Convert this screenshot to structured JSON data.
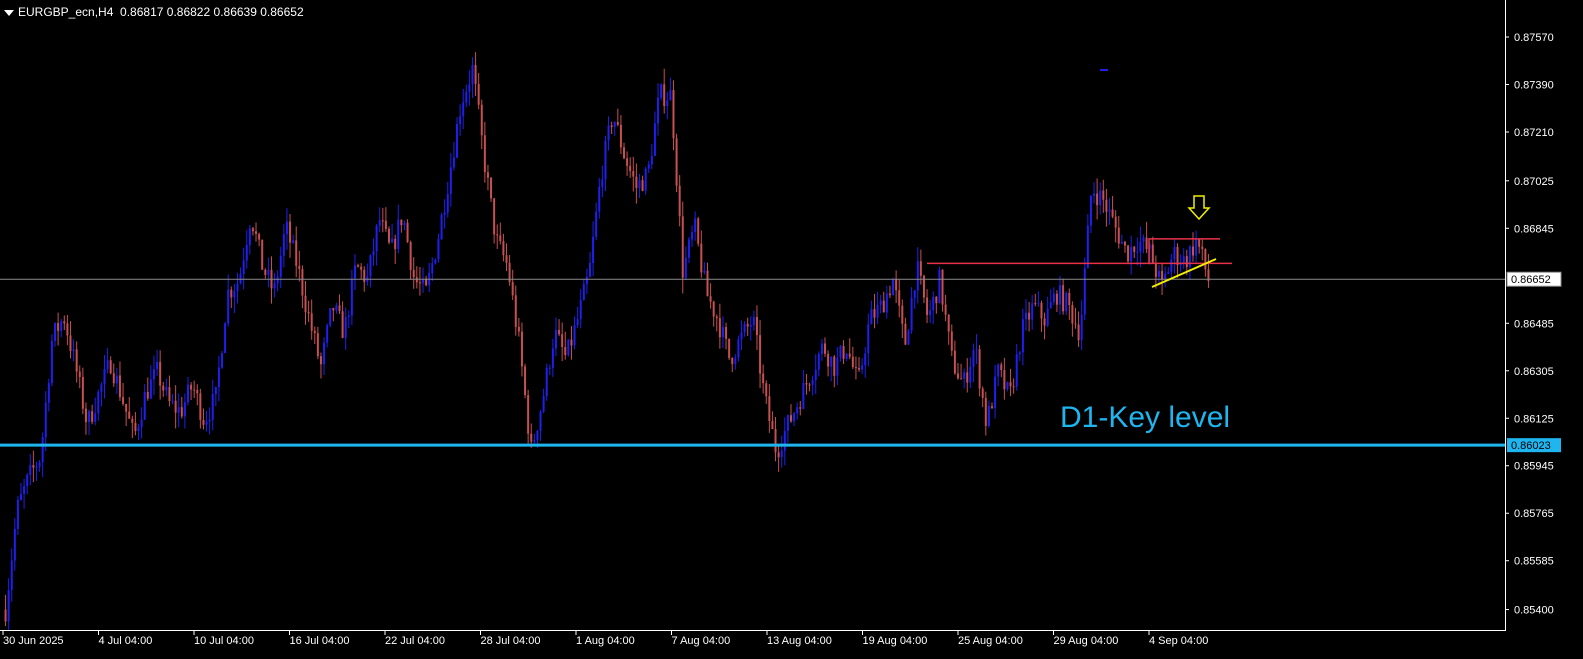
{
  "header": {
    "symbol": "EURGBP_ecn,H4",
    "open": "0.86817",
    "high": "0.86822",
    "low": "0.86639",
    "close": "0.86652"
  },
  "annotation": {
    "key_level_label": "D1-Key level"
  },
  "colors": {
    "background": "#000000",
    "bull_candle": "#1f1ff0",
    "bear_candle": "#c85050",
    "key_level_line": "#1fb6f0",
    "current_price_line": "#8c8c8c",
    "resistance_line": "#e8324a",
    "trendline": "#f0f000",
    "arrow": "#f0f000",
    "axis_text": "#ffffff"
  },
  "chart_data": {
    "type": "candlestick",
    "ylim": [
      0.8533,
      0.8768
    ],
    "y_ticks": [
      "0.87570",
      "0.87390",
      "0.87210",
      "0.87025",
      "0.86845",
      "0.86485",
      "0.86305",
      "0.86125",
      "0.85945",
      "0.85765",
      "0.85585",
      "0.85400"
    ],
    "x_ticks": [
      "30 Jun 2025",
      "4 Jul 04:00",
      "10 Jul 04:00",
      "16 Jul 04:00",
      "22 Jul 04:00",
      "28 Jul 04:00",
      "1 Aug 04:00",
      "7 Aug 04:00",
      "13 Aug 04:00",
      "19 Aug 04:00",
      "25 Aug 04:00",
      "29 Aug 04:00",
      "4 Sep 04:00"
    ],
    "current_price": 0.86652,
    "current_price_label": "0.86652",
    "key_level": 0.86023,
    "key_level_label": "0.86023",
    "resistance_level": 0.86712,
    "consolidation_high": 0.86805,
    "close_path": [
      0.854,
      0.8578,
      0.859,
      0.8598,
      0.8643,
      0.8651,
      0.8632,
      0.861,
      0.8622,
      0.8634,
      0.862,
      0.8605,
      0.8622,
      0.863,
      0.8618,
      0.8615,
      0.8625,
      0.8612,
      0.862,
      0.866,
      0.8665,
      0.869,
      0.867,
      0.866,
      0.8685,
      0.867,
      0.865,
      0.8632,
      0.8655,
      0.8645,
      0.867,
      0.8665,
      0.8688,
      0.8675,
      0.869,
      0.8665,
      0.866,
      0.868,
      0.8705,
      0.8732,
      0.8745,
      0.871,
      0.868,
      0.867,
      0.864,
      0.86,
      0.862,
      0.8645,
      0.8635,
      0.865,
      0.8668,
      0.8705,
      0.8728,
      0.8712,
      0.87,
      0.8705,
      0.8735,
      0.8735,
      0.8668,
      0.8685,
      0.866,
      0.865,
      0.8635,
      0.8643,
      0.865,
      0.862,
      0.86,
      0.861,
      0.862,
      0.863,
      0.864,
      0.8632,
      0.864,
      0.8625,
      0.865,
      0.8655,
      0.8665,
      0.864,
      0.867,
      0.865,
      0.8665,
      0.8635,
      0.8625,
      0.864,
      0.861,
      0.863,
      0.862,
      0.8645,
      0.8655,
      0.865,
      0.866,
      0.8655,
      0.8645,
      0.87,
      0.8695,
      0.8685,
      0.8675,
      0.868,
      0.8675,
      0.8662,
      0.8675,
      0.8672,
      0.868,
      0.8665
    ],
    "swing_high": {
      "x": 1104,
      "price": 0.87445
    }
  }
}
